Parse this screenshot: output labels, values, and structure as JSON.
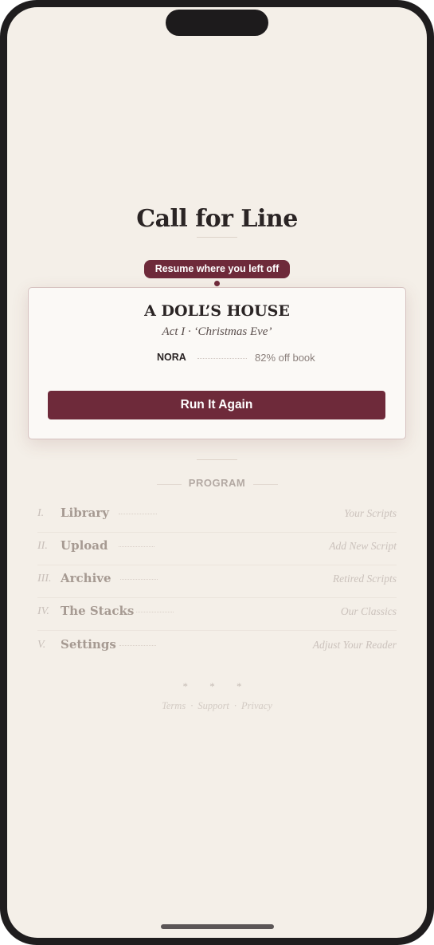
{
  "app": {
    "title": "Call for Line"
  },
  "resume": {
    "label": "Resume where you left off",
    "play_title": "A DOLL’S HOUSE",
    "scene": "Act I · ‘Christmas Eve’",
    "role": "NORA",
    "progress": "82% off book",
    "cta": "Run It Again"
  },
  "program": {
    "heading": "PROGRAM",
    "items": [
      {
        "num": "I.",
        "label": "Library",
        "sub": "Your Scripts"
      },
      {
        "num": "II.",
        "label": "Upload",
        "sub": "Add New Script"
      },
      {
        "num": "III.",
        "label": "Archive",
        "sub": "Retired Scripts"
      },
      {
        "num": "IV.",
        "label": "The Stacks",
        "sub": "Our Classics"
      },
      {
        "num": "V.",
        "label": "Settings",
        "sub": "Adjust Your Reader"
      }
    ]
  },
  "footer": {
    "ornament": "* * *",
    "links": [
      "Terms",
      "Support",
      "Privacy"
    ]
  },
  "colors": {
    "accent": "#6e2a3a",
    "background": "#f4efe8",
    "card": "#fbf9f6"
  }
}
